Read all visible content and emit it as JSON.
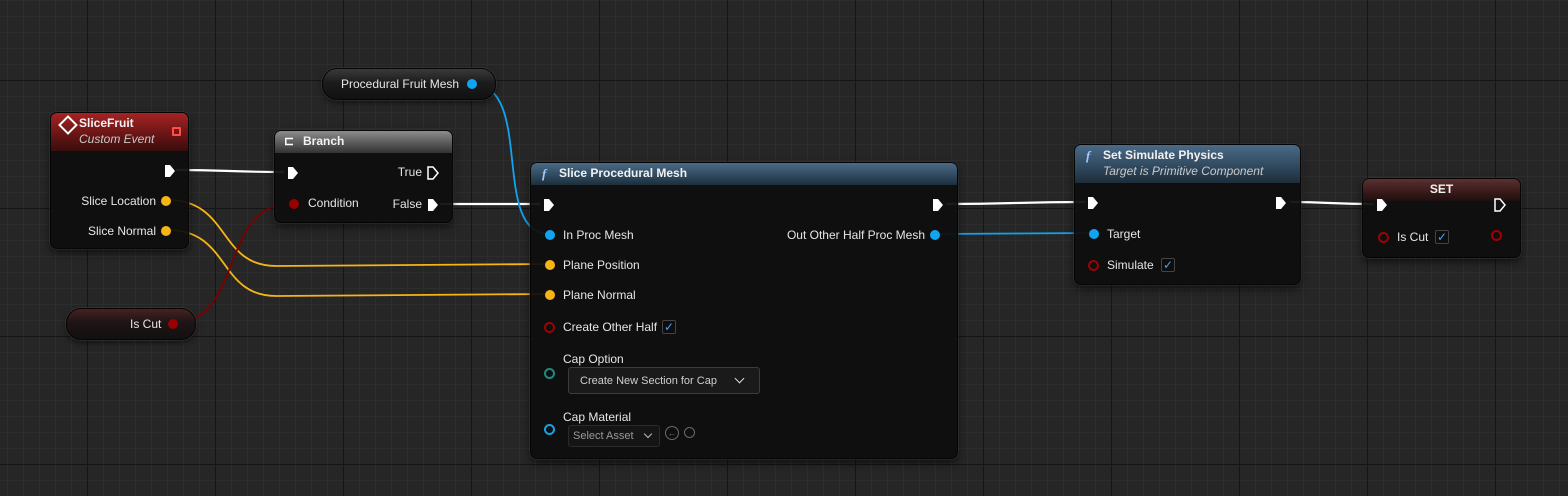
{
  "graph": {
    "nodes": {
      "slice_fruit": {
        "title": "SliceFruit",
        "subtitle": "Custom Event",
        "pins": {
          "slice_location": "Slice Location",
          "slice_normal": "Slice Normal"
        }
      },
      "branch": {
        "title": "Branch",
        "pins": {
          "condition": "Condition",
          "true": "True",
          "false": "False"
        }
      },
      "procedural_fruit_mesh": {
        "label": "Procedural Fruit Mesh"
      },
      "is_cut_getter": {
        "label": "Is Cut"
      },
      "slice_procedural_mesh": {
        "title": "Slice Procedural Mesh",
        "function_icon": "f",
        "pins": {
          "in_proc_mesh": "In Proc Mesh",
          "plane_position": "Plane Position",
          "plane_normal": "Plane Normal",
          "create_other_half": "Create Other Half",
          "cap_option": "Cap Option",
          "cap_material": "Cap Material",
          "out_other_half": "Out Other Half Proc Mesh"
        },
        "create_other_half_checked": "✓",
        "cap_option_value": "Create New Section for Cap",
        "cap_material_value": "Select Asset"
      },
      "set_simulate_physics": {
        "title": "Set Simulate Physics",
        "subtitle": "Target is Primitive Component",
        "function_icon": "f",
        "pins": {
          "target": "Target",
          "simulate": "Simulate"
        },
        "simulate_checked": "✓"
      },
      "set_node": {
        "title": "SET",
        "pins": {
          "is_cut": "Is Cut"
        },
        "is_cut_checked": "✓"
      }
    },
    "icons": [
      "event-diamond-icon",
      "branch-icon",
      "function-icon",
      "chevron-down-icon",
      "browse-arrow-icon",
      "search-icon"
    ],
    "colors": {
      "exec": "#ffffff",
      "vector": "#f6b417",
      "object": "#10a4f0",
      "bool": "#a00000",
      "enum": "#1d8b7e",
      "event_header": "#a52323",
      "function_header": "#4a6a86"
    }
  }
}
